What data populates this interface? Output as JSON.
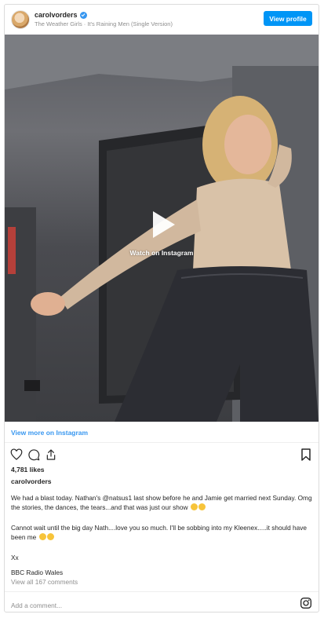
{
  "header": {
    "username": "carolvorders",
    "subtitle": "The Weather Girls · It's Raining Men (Single Version)",
    "view_profile_label": "View profile",
    "verified_color": "#3897f0",
    "button_color": "#0095f6"
  },
  "media": {
    "watch_label": "Watch on Instagram"
  },
  "view_more_label": "View more on Instagram",
  "post": {
    "likes": "4,781 likes",
    "author": "carolvorders",
    "caption_1": "We had a blast today. Nathan's @natsus1 last show before he and Jamie get married next Sunday. Omg the stories, the dances, the tears...and that was just our show",
    "caption_2": "Cannot wait until the big day Nath....love you so much. I'll be sobbing into my Kleenex.....it should have been me",
    "caption_3": "Xx",
    "caption_4": "BBC Radio Wales",
    "view_comments": "View all 167 comments"
  },
  "comment_input": {
    "placeholder": "Add a comment..."
  },
  "icons": {
    "like": "heart-icon",
    "comment": "comment-icon",
    "share": "share-icon",
    "save": "bookmark-icon",
    "brand": "instagram-icon"
  }
}
